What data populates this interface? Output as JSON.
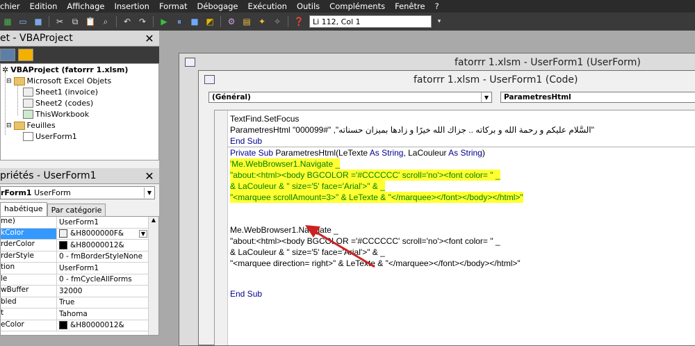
{
  "menu": [
    "chier",
    "Edition",
    "Affichage",
    "Insertion",
    "Format",
    "Débogage",
    "Exécution",
    "Outils",
    "Compléments",
    "Fenêtre",
    "?"
  ],
  "toolbar": {
    "position_text": "Li 112, Col 1"
  },
  "project_panel": {
    "title": "et - VBAProject",
    "tree": {
      "root": "VBAProject (fatorrr 1.xlsm)",
      "excel_folder": "Microsoft Excel Objets",
      "sheet1": "Sheet1 (invoice)",
      "sheet2": "Sheet2 (codes)",
      "workbook": "ThisWorkbook",
      "forms_folder": "Feuilles",
      "userform": "UserForm1"
    }
  },
  "properties_panel": {
    "title": "priétés - UserForm1",
    "object_name": "rForm1",
    "object_type": "UserForm",
    "tabs": [
      "habétique",
      "Par catégorie"
    ],
    "rows": [
      {
        "k": "me)",
        "v": "UserForm1"
      },
      {
        "k": "kColor",
        "v": "&H8000000F&"
      },
      {
        "k": "rderColor",
        "v": "&H80000012&"
      },
      {
        "k": "rderStyle",
        "v": "0 - fmBorderStyleNone"
      },
      {
        "k": "tion",
        "v": "UserForm1"
      },
      {
        "k": "le",
        "v": "0 - fmCycleAllForms"
      },
      {
        "k": "wBuffer",
        "v": "32000"
      },
      {
        "k": "bled",
        "v": "True"
      },
      {
        "k": "t",
        "v": "Tahoma"
      },
      {
        "k": "eColor",
        "v": "&H80000012&"
      }
    ]
  },
  "form_window": {
    "title": "fatorrr 1.xlsm - UserForm1 (UserForm)"
  },
  "code_window": {
    "title": "fatorrr 1.xlsm - UserForm1 (Code)",
    "object_dropdown": "(Général)",
    "proc_dropdown": "ParametresHtml",
    "lines": {
      "l1": "TextFind.SetFocus",
      "l2a": "ParametresHtml \"السَّلام عليكم و رحمة الله و بركاته .. جزاك الله خيرًا و زادها بميزان حسناته\", \"#000099\"",
      "l3": "End Sub",
      "l4a": "Private Sub",
      "l4b": " ParametresHtml(LeTexte ",
      "l4c": "As String",
      "l4d": ", LaCouleur ",
      "l4e": "As String",
      "l4f": ")",
      "c1": "'Me.WebBrowser1.Navigate _",
      "c2": "\"about:<html><body BGCOLOR ='#CCCCCC' scroll='no'><font color= \" _",
      "c3": "& LaCouleur & \" size='5' face='Arial'>\" & _",
      "c4": "\"<marquee scrollAmount=3>\" & LeTexte & \"</marquee></font></body></html>\"",
      "n1": "Me.WebBrowser1.Navigate _",
      "n2": "\"about:<html><body BGCOLOR ='#CCCCCC' scroll='no'><font color= \" _",
      "n3": "& LaCouleur & \" size='5' face='Arial'>\" & _",
      "n4": "\"<marquee direction= right>\" & LeTexte & \"</marquee></font></body></html>\"",
      "end": "End Sub"
    }
  },
  "colors": {
    "highlight": "#ffff33",
    "comment": "#008000",
    "keyword": "#00008b",
    "arrow": "#cc2222"
  }
}
